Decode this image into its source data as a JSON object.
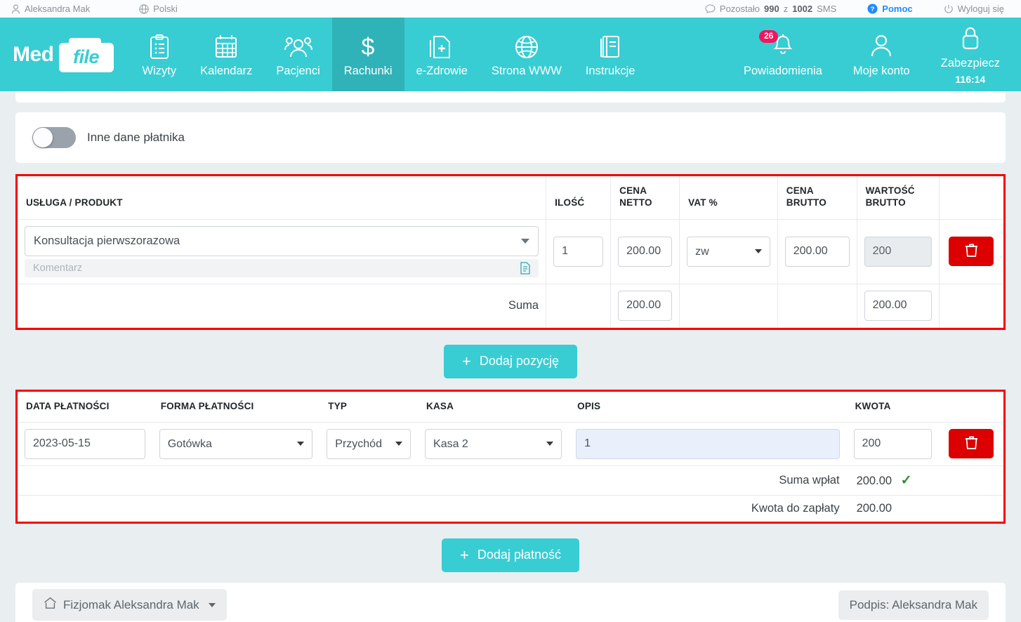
{
  "topbar": {
    "user_icon": "user-icon",
    "user_name": "Aleksandra Mak",
    "lang_icon": "globe-icon",
    "lang": "Polski",
    "sms_icon": "chat-bubble-icon",
    "sms_prefix": "Pozostało",
    "sms_used": "990",
    "sms_mid": "z",
    "sms_total": "1002",
    "sms_suffix": "SMS",
    "help_icon": "question-circle-icon",
    "help": "Pomoc",
    "logout_icon": "power-icon",
    "logout": "Wyloguj się"
  },
  "brand": {
    "med": "Med",
    "file": "file"
  },
  "nav": {
    "active": "Rachunki",
    "items": [
      {
        "label": "Wizyty",
        "icon": "clipboard-icon"
      },
      {
        "label": "Kalendarz",
        "icon": "calendar-icon"
      },
      {
        "label": "Pacjenci",
        "icon": "users-icon"
      },
      {
        "label": "Rachunki",
        "icon": "dollar-icon"
      },
      {
        "label": "e-Zdrowie",
        "icon": "medical-file-icon"
      },
      {
        "label": "Strona WWW",
        "icon": "globe-icon"
      },
      {
        "label": "Instrukcje",
        "icon": "book-icon"
      }
    ],
    "right": [
      {
        "label": "Powiadomienia",
        "icon": "bell-icon",
        "badge": "26"
      },
      {
        "label": "Moje konto",
        "icon": "person-icon"
      },
      {
        "label": "Zabezpiecz",
        "icon": "lock-icon",
        "timer": "116:14"
      }
    ]
  },
  "payer_toggle": {
    "label": "Inne dane płatnika",
    "state": "off"
  },
  "items_table": {
    "headers": {
      "service": "USŁUGA / PRODUKT",
      "qty": "ILOŚĆ",
      "net_price": "CENA\nNETTO",
      "vat": "VAT %",
      "gross_price": "CENA\nBRUTTO",
      "gross_value": "WARTOŚĆ\nBRUTTO",
      "actions": ""
    },
    "rows": [
      {
        "service": "Konsultacja pierwszorazowa",
        "comment_placeholder": "Komentarz",
        "comment_icon": "document-icon",
        "qty": "1",
        "net_price": "200.00",
        "vat": "zw",
        "gross_price": "200.00",
        "gross_value": "200",
        "delete_icon": "trash-icon"
      }
    ],
    "total_label": "Suma",
    "total_net": "200.00",
    "total_gross": "200.00"
  },
  "add_item_button": {
    "plus": "+",
    "label": "Dodaj pozycję"
  },
  "payments_table": {
    "headers": {
      "date": "DATA PŁATNOŚCI",
      "form": "FORMA PŁATNOŚCI",
      "type": "TYP",
      "register": "KASA",
      "description": "OPIS",
      "amount": "KWOTA",
      "actions": ""
    },
    "rows": [
      {
        "date": "2023-05-15",
        "form": "Gotówka",
        "type": "Przychód",
        "register": "Kasa 2",
        "description": "1",
        "amount": "200",
        "delete_icon": "trash-icon"
      }
    ],
    "sum_paid_label": "Suma wpłat",
    "sum_paid_value": "200.00",
    "sum_paid_check": "check-icon",
    "due_label": "Kwota do zapłaty",
    "due_value": "200.00"
  },
  "add_payment_button": {
    "plus": "+",
    "label": "Dodaj płatność"
  },
  "footer": {
    "facility_icon": "home-icon",
    "facility": "Fizjomak Aleksandra Mak",
    "signature": "Podpis: Aleksandra Mak"
  },
  "colors": {
    "brand_teal": "#37cdd3",
    "brand_teal_dark": "#2fb3b8",
    "danger_red": "#dc0000",
    "highlight_border": "#f50000",
    "badge_pink": "#f5145e",
    "help_blue": "#1e8bff",
    "check_green": "#2e8b2e"
  }
}
